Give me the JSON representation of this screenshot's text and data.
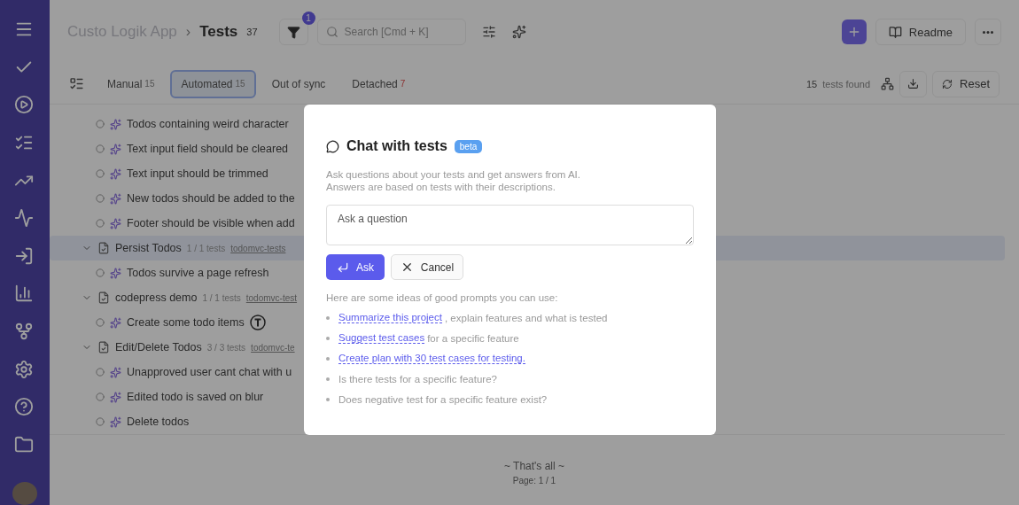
{
  "header": {
    "project": "Custo Logik App",
    "separator": "›",
    "title": "Tests",
    "count": "37",
    "filter_badge": "1",
    "search": {
      "placeholder": "Search [Cmd + K]"
    },
    "readme_button": "Readme"
  },
  "tabs": [
    {
      "label": "Manual",
      "count": "15",
      "selected": false,
      "alert": false
    },
    {
      "label": "Automated",
      "count": "15",
      "selected": true,
      "alert": false
    },
    {
      "label": "Out of sync",
      "selected": false
    },
    {
      "label": "Detached",
      "count": "7",
      "selected": false,
      "alert": true
    }
  ],
  "toolbar": {
    "found_count": "15",
    "found_label": "tests found",
    "reset_button": "Reset"
  },
  "tree": [
    {
      "kind": "test",
      "title": "Todos containing weird character"
    },
    {
      "kind": "test",
      "title": "Text input field should be cleared"
    },
    {
      "kind": "test",
      "title": "Text input should be trimmed"
    },
    {
      "kind": "test",
      "title": "New todos should be added to the"
    },
    {
      "kind": "test",
      "title": "Footer should be visible when add"
    },
    {
      "kind": "suite",
      "title": "Persist Todos",
      "tests": "1 / 1 tests",
      "tag": "todomvc-tests",
      "expanded": true,
      "selected": true,
      "children": [
        {
          "kind": "test",
          "title": "Todos survive a page refresh"
        }
      ]
    },
    {
      "kind": "suite",
      "title": "codepress demo",
      "tests": "1 / 1 tests",
      "tag": "todomvc-test",
      "expanded": true,
      "selected": false,
      "children": [
        {
          "kind": "test",
          "title": "Create some todo items",
          "typed": true
        }
      ]
    },
    {
      "kind": "suite",
      "title": "Edit/Delete Todos",
      "tests": "3 / 3 tests",
      "tag": "todomvc-te",
      "expanded": true,
      "selected": false,
      "children": [
        {
          "kind": "test",
          "title": "Unapproved user cant chat with u"
        },
        {
          "kind": "test",
          "title": "Edited todo is saved on blur"
        },
        {
          "kind": "test",
          "title": "Delete todos"
        }
      ]
    }
  ],
  "footer": {
    "end_text": "~ That's all ~",
    "page": "Page: 1 / 1"
  },
  "modal": {
    "title": "Chat with tests",
    "badge": "beta",
    "description": [
      "Ask questions about your tests and get answers from AI.",
      "Answers are based on tests with their descriptions."
    ],
    "question": {
      "placeholder": "Ask a question"
    },
    "ask_button": "Ask",
    "cancel_button": "Cancel",
    "prompts_intro": "Here are some ideas of good prompts you can use:",
    "prompts": [
      {
        "kind": "link",
        "link": "Summarize this project",
        "rest": ", explain features and what is tested"
      },
      {
        "kind": "link",
        "link": "Suggest test cases",
        "rest": "for a specific feature"
      },
      {
        "kind": "link",
        "link": "Create plan with 30 test cases for testing."
      },
      {
        "kind": "plain",
        "rest": "Is there tests for a specific feature?"
      },
      {
        "kind": "plain",
        "rest": "Does negative test for a specific feature exist?"
      }
    ]
  }
}
